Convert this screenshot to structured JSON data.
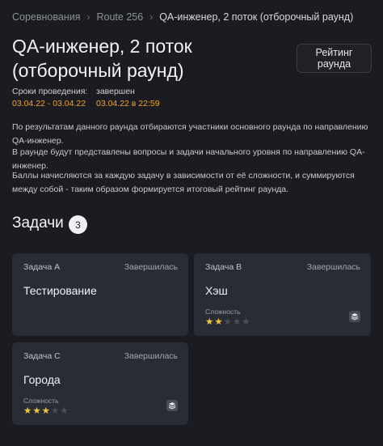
{
  "breadcrumb": {
    "items": [
      "Соревнования",
      "Route 256"
    ],
    "current": "QA-инженер, 2 поток (отборочный раунд)"
  },
  "page": {
    "title": "QA-инженер, 2 поток (отборочный раунд)",
    "rating_button": "Рейтинг раунда"
  },
  "meta": {
    "period_label": "Сроки проведения:",
    "period_value": "03.04.22 - 03.04.22",
    "finished_label": "завершен",
    "finished_value": "03.04.22 в 22:59"
  },
  "description": [
    "По результатам данного раунда отбираются участники основного раунда по направлению QA-инженер.",
    "В раунде будут представлены вопросы и задачи начального уровня по направлению QA-инженер.",
    "Баллы начисляются за каждую задачу в зависимости от её сложности, и суммируются между собой - таким образом формируется итоговый рейтинг раунда."
  ],
  "tasks_section": {
    "title": "Задачи",
    "count": "3"
  },
  "difficulty_label": "Сложность",
  "colors": {
    "accent_date": "#f0a32a",
    "star_on": "#f3c63a",
    "star_off": "#4d4f58",
    "card_bg": "#2a2c35",
    "page_bg": "#1b1c21"
  },
  "tasks": [
    {
      "label": "Задача A",
      "status": "Завершилась",
      "name": "Тестирование",
      "difficulty": null,
      "max_stars": 5,
      "icon": "stack-icon"
    },
    {
      "label": "Задача B",
      "status": "Завершилась",
      "name": "Хэш",
      "difficulty": 2,
      "max_stars": 5,
      "icon": "stack-icon"
    },
    {
      "label": "Задача C",
      "status": "Завершилась",
      "name": "Города",
      "difficulty": 3,
      "max_stars": 5,
      "icon": "stack-icon"
    }
  ]
}
